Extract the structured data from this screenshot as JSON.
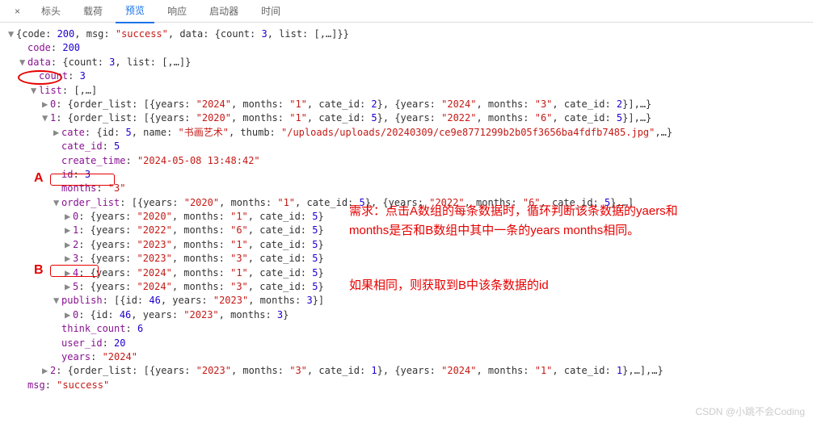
{
  "tabs": {
    "close": "×",
    "headers": "标头",
    "payload": "载荷",
    "preview": "预览",
    "response": "响应",
    "initiator": "启动器",
    "timing": "时间"
  },
  "colors": {
    "key": "#881391",
    "string": "#c41a16",
    "number": "#1c00cf",
    "annotation": "#e60000"
  },
  "chart_data": {
    "type": "table",
    "response": {
      "code": 200,
      "msg": "success",
      "data": {
        "count": 3,
        "list": [
          {
            "order_list": [
              {
                "years": "2024",
                "months": "1",
                "cate_id": 2
              },
              {
                "years": "2024",
                "months": "3",
                "cate_id": 2
              }
            ]
          },
          {
            "cate": {
              "id": 5,
              "name": "书画艺术",
              "thumb": "/uploads/uploads/20240309/ce9e8771299b2b05f3656ba4fdfb7485.jpg"
            },
            "cate_id": 5,
            "create_time": "2024-05-08 13:48:42",
            "id": 3,
            "months": "3",
            "order_list": [
              {
                "years": "2020",
                "months": "1",
                "cate_id": 5
              },
              {
                "years": "2022",
                "months": "6",
                "cate_id": 5
              },
              {
                "years": "2023",
                "months": "1",
                "cate_id": 5
              },
              {
                "years": "2023",
                "months": "3",
                "cate_id": 5
              },
              {
                "years": "2024",
                "months": "1",
                "cate_id": 5
              },
              {
                "years": "2024",
                "months": "3",
                "cate_id": 5
              }
            ],
            "publish": [
              {
                "id": 46,
                "years": "2023",
                "months": 3
              }
            ],
            "think_count": 6,
            "user_id": 20,
            "years": "2024"
          },
          {
            "order_list": [
              {
                "years": "2023",
                "months": "3",
                "cate_id": 1
              },
              {
                "years": "2024",
                "months": "1",
                "cate_id": 1
              }
            ]
          }
        ]
      }
    }
  },
  "labels": {
    "A": "A",
    "B": "B"
  },
  "annotation": {
    "line1": "需求：点击A数组的每条数据时，循环判断该条数据的yaers和",
    "line2": "months是否和B数组中其中一条的years months相同。",
    "line3": "如果相同，则获取到B中该条数据的id"
  },
  "watermark": "CSDN @小跳不会Coding"
}
